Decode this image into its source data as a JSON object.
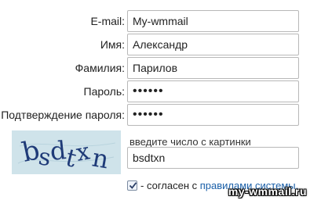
{
  "form": {
    "email": {
      "label": "E-mail:",
      "value": "My-wmmail"
    },
    "first_name": {
      "label": "Имя:",
      "value": "Александр"
    },
    "last_name": {
      "label": "Фамилия:",
      "value": "Парилов"
    },
    "password": {
      "label": "Пароль:",
      "value": "••••••"
    },
    "password_confirm": {
      "label": "Подтверждение пароля:",
      "value": "••••••"
    }
  },
  "captcha": {
    "image_text": "bsdtxn",
    "hint": "введите число с картинки",
    "value": "bsdtxn"
  },
  "agreement": {
    "checked": true,
    "text_prefix": "- согласен с ",
    "link_text": "правилами системы."
  },
  "watermark": "my-wmmail.ru",
  "colors": {
    "captcha_bg": "#cfe3ea",
    "captcha_ink": "#1f3b78",
    "link": "#1a5fa8"
  }
}
